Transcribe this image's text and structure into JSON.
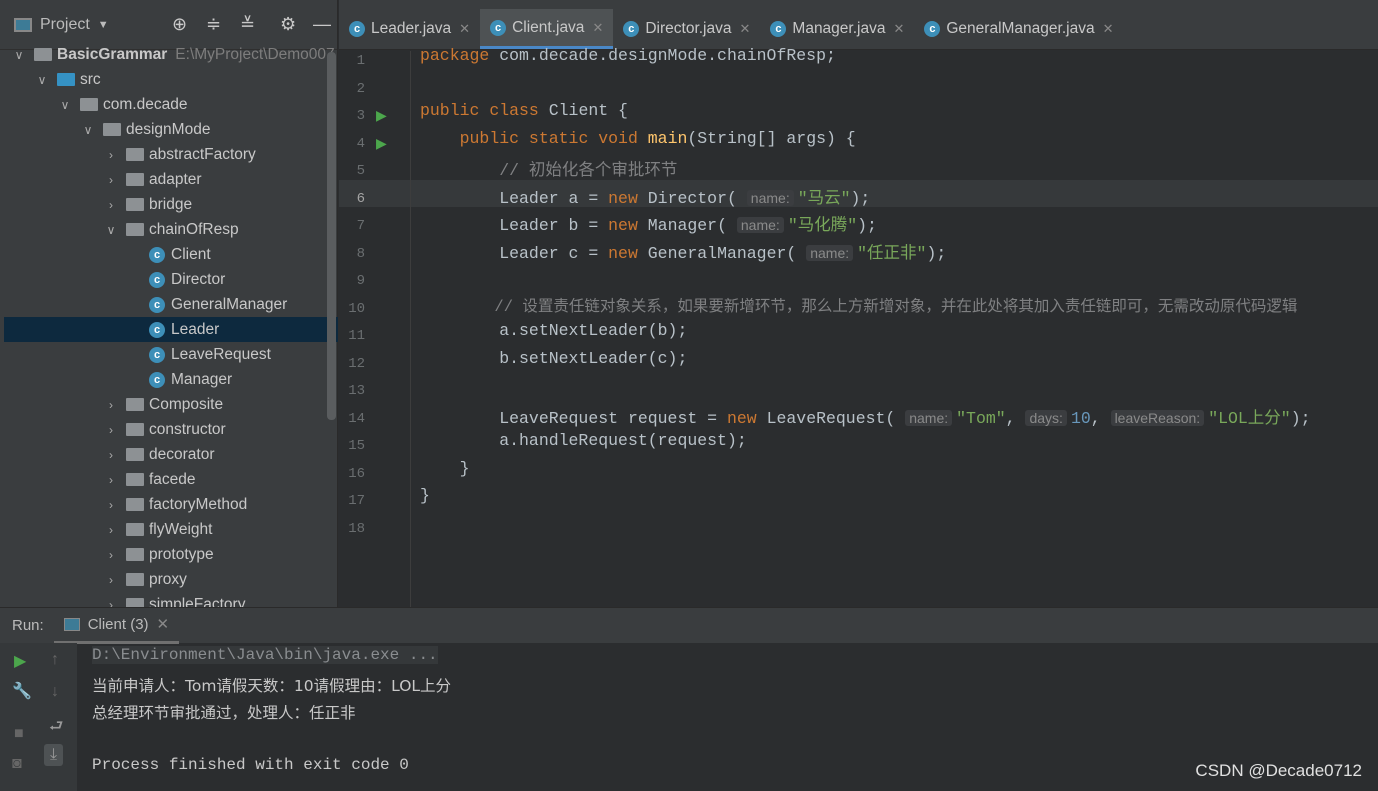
{
  "sidebar": {
    "title": "Project",
    "project_name": "BasicGrammar",
    "project_path": "E:\\MyProject\\Demo007",
    "tree": [
      {
        "label": "src",
        "level": 1,
        "type": "src"
      },
      {
        "label": "com.decade",
        "level": 2,
        "type": "pkg"
      },
      {
        "label": "designMode",
        "level": 3,
        "type": "pkg"
      },
      {
        "label": "abstractFactory",
        "level": 4,
        "type": "pkg",
        "collapsed": true
      },
      {
        "label": "adapter",
        "level": 4,
        "type": "pkg",
        "collapsed": true
      },
      {
        "label": "bridge",
        "level": 4,
        "type": "pkg",
        "collapsed": true
      },
      {
        "label": "chainOfResp",
        "level": 4,
        "type": "pkg"
      },
      {
        "label": "Client",
        "level": 5,
        "type": "class"
      },
      {
        "label": "Director",
        "level": 5,
        "type": "class"
      },
      {
        "label": "GeneralManager",
        "level": 5,
        "type": "class"
      },
      {
        "label": "Leader",
        "level": 5,
        "type": "class",
        "selected": true
      },
      {
        "label": "LeaveRequest",
        "level": 5,
        "type": "class"
      },
      {
        "label": "Manager",
        "level": 5,
        "type": "class"
      },
      {
        "label": "Composite",
        "level": 4,
        "type": "pkg",
        "collapsed": true
      },
      {
        "label": "constructor",
        "level": 4,
        "type": "pkg",
        "collapsed": true
      },
      {
        "label": "decorator",
        "level": 4,
        "type": "pkg",
        "collapsed": true
      },
      {
        "label": "facede",
        "level": 4,
        "type": "pkg",
        "collapsed": true
      },
      {
        "label": "factoryMethod",
        "level": 4,
        "type": "pkg",
        "collapsed": true
      },
      {
        "label": "flyWeight",
        "level": 4,
        "type": "pkg",
        "collapsed": true
      },
      {
        "label": "prototype",
        "level": 4,
        "type": "pkg",
        "collapsed": true
      },
      {
        "label": "proxy",
        "level": 4,
        "type": "pkg",
        "collapsed": true
      },
      {
        "label": "simpleFactory",
        "level": 4,
        "type": "pkg",
        "collapsed": true
      }
    ]
  },
  "tabs": [
    {
      "label": "Leader.java"
    },
    {
      "label": "Client.java",
      "active": true
    },
    {
      "label": "Director.java"
    },
    {
      "label": "Manager.java"
    },
    {
      "label": "GeneralManager.java"
    }
  ],
  "code": {
    "line_numbers": [
      "1",
      "2",
      "3",
      "4",
      "5",
      "6",
      "7",
      "8",
      "9",
      "10",
      "11",
      "12",
      "13",
      "14",
      "15",
      "16",
      "17",
      "18"
    ],
    "current_line": 6,
    "t": {
      "package": "package",
      "pkgname": " com.decade.designMode.chainOfResp;",
      "public": "public",
      "class": " class",
      "Client": " Client {",
      "static": " static void",
      "main": "main",
      "mainargs": "(String[] args) {",
      "c1": "// 初始化各个审批环节",
      "l6a": "Leader a = ",
      "new": "new",
      "l6b": " Director(",
      "h_name": "name:",
      "s1": "\"马云\"",
      "end": ");",
      "l7a": "Leader b = ",
      "l7b": " Manager(",
      "s2": "\"马化腾\"",
      "l8a": "Leader c = ",
      "l8b": " GeneralManager(",
      "s3": "\"任正非\"",
      "c2": "// 设置责任链对象关系，如果要新增环节，那么上方新增对象，并在此处将其加入责任链即可，无需改动原代码逻辑",
      "l11": "a.setNextLeader(b);",
      "l12": "b.setNextLeader(c);",
      "l14a": "LeaveRequest request = ",
      "l14b": " LeaveRequest(",
      "s4": "\"Tom\"",
      "comma": ", ",
      "h_days": "days:",
      "n10": "10",
      "h_reason": "leaveReason:",
      "s5": "\"LOL上分\"",
      "l15": "a.handleRequest(request);",
      "rb": "}"
    }
  },
  "run": {
    "label": "Run:",
    "tab": "Client (3)",
    "output": [
      "D:\\Environment\\Java\\bin\\java.exe ...",
      "当前申请人：Tom请假天数：10请假理由：LOL上分",
      "总经理环节审批通过，处理人：任正非",
      "",
      "Process finished with exit code 0"
    ]
  },
  "watermark": "CSDN @Decade0712"
}
